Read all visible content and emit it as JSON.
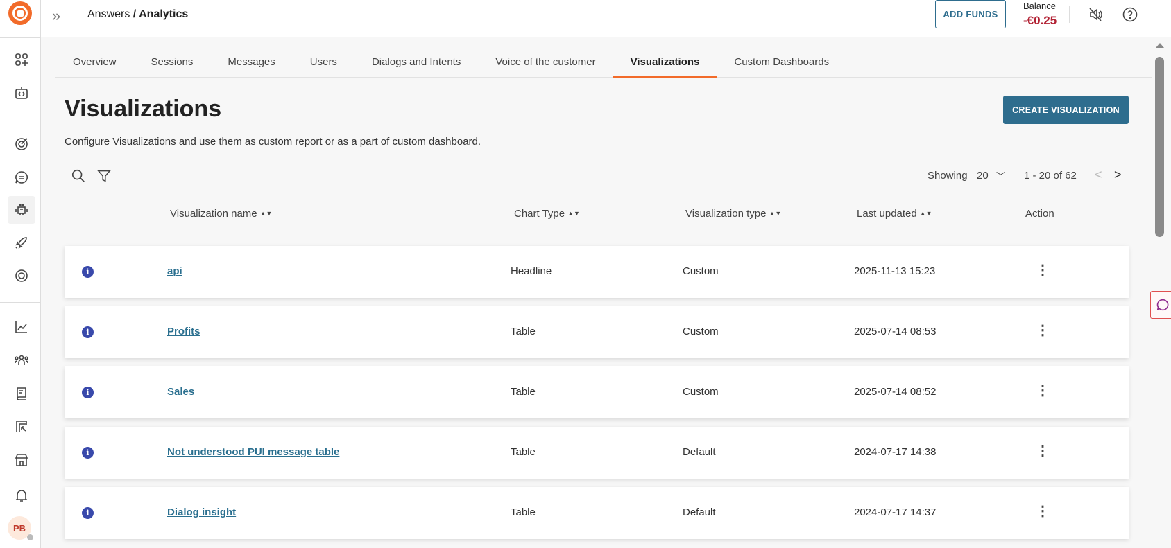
{
  "header": {
    "breadcrumb_parent": "Answers",
    "breadcrumb_sep": " / ",
    "breadcrumb_current": "Analytics",
    "add_funds": "ADD FUNDS",
    "balance_label": "Balance",
    "balance_value": "-€0.25"
  },
  "user": {
    "initials": "PB"
  },
  "tabs": [
    "Overview",
    "Sessions",
    "Messages",
    "Users",
    "Dialogs and Intents",
    "Voice of the customer",
    "Visualizations",
    "Custom Dashboards"
  ],
  "page": {
    "title": "Visualizations",
    "description": "Configure Visualizations and use them as custom report or as a part of custom dashboard.",
    "create_button": "CREATE VISUALIZATION"
  },
  "pagination": {
    "showing_label": "Showing",
    "page_size": "20",
    "range": "1 - 20 of 62"
  },
  "table": {
    "columns": [
      "Visualization name",
      "Chart Type",
      "Visualization type",
      "Last updated",
      "Action"
    ],
    "rows": [
      {
        "name": "api",
        "chart_type": "Headline",
        "viz_type": "Custom",
        "updated": "2025-11-13 15:23"
      },
      {
        "name": "Profits",
        "chart_type": "Table",
        "viz_type": "Custom",
        "updated": "2025-07-14 08:53"
      },
      {
        "name": "Sales",
        "chart_type": "Table",
        "viz_type": "Custom",
        "updated": "2025-07-14 08:52"
      },
      {
        "name": "Not understood PUI message table",
        "chart_type": "Table",
        "viz_type": "Default",
        "updated": "2024-07-17 14:38"
      },
      {
        "name": "Dialog insight",
        "chart_type": "Table",
        "viz_type": "Default",
        "updated": "2024-07-17 14:37"
      }
    ]
  },
  "colors": {
    "accent": "#f26b2a",
    "primary": "#2e6d8e",
    "negative": "#b22234"
  }
}
